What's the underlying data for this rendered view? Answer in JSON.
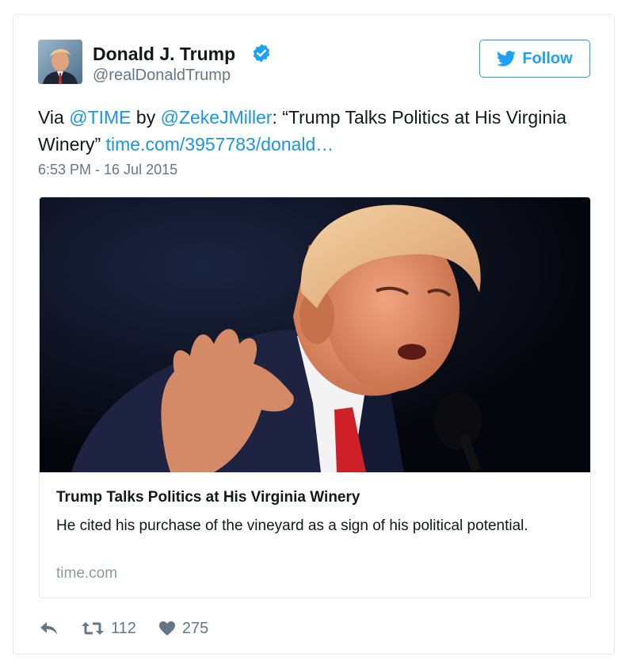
{
  "author": {
    "name": "Donald J. Trump",
    "handle": "@realDonaldTrump",
    "verified_icon": "verified-badge-icon",
    "avatar": "avatar-photo"
  },
  "follow_button": {
    "label": "Follow",
    "icon": "twitter-bird-icon"
  },
  "tweet": {
    "prefix": "Via ",
    "mention1": "@TIME",
    "by": " by ",
    "mention2": "@ZekeJMiller",
    "quote": ": “Trump Talks Politics at His Virginia Winery” ",
    "link": "time.com/3957783/donald…",
    "timestamp": "6:53 PM - 16 Jul 2015"
  },
  "card": {
    "image": "article-photo",
    "title": "Trump Talks Politics at His Virginia Winery",
    "description": "He cited his purchase of the vineyard as a sign of his political potential.",
    "domain": "time.com"
  },
  "actions": {
    "reply_icon": "reply-icon",
    "retweet_icon": "retweet-icon",
    "retweet_count": "112",
    "like_icon": "heart-icon",
    "like_count": "275"
  },
  "colors": {
    "link": "#1b95e0",
    "follow": "#1da1f2",
    "secondary_text": "#657786",
    "border": "#e1e8ed"
  }
}
